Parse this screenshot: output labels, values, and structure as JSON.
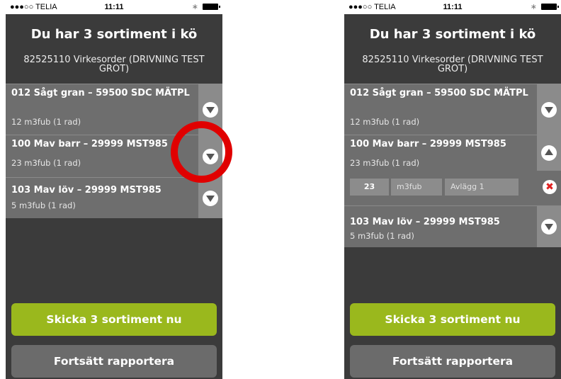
{
  "status_bar": {
    "carrier": "●●●○○ TELIA",
    "time": "11:11",
    "bluetooth": "∗"
  },
  "colors": {
    "background": "#3b3b3b",
    "item": "#6e6e6e",
    "toggle": "#8b8b8b",
    "primary": "#9ab81d",
    "secondary": "#6b6b6b",
    "highlight": "#e00000"
  },
  "left_screen": {
    "title": "Du har 3 sortiment i kö",
    "subtitle": "82525110 Virkesorder (DRIVNING TEST GROT)",
    "items": [
      {
        "title": "012 Sågt gran – 59500 SDC MÄTPL",
        "sub": "12 m3fub (1 rad)",
        "icon": "chevron-down-icon"
      },
      {
        "title": "100 Mav barr – 29999 MST985",
        "sub": "23 m3fub (1 rad)",
        "icon": "chevron-down-icon"
      },
      {
        "title": "103 Mav löv – 29999 MST985",
        "sub": "5 m3fub (1 rad)",
        "icon": "chevron-down-icon"
      }
    ],
    "send_button": "Skicka 3 sortiment nu",
    "continue_button": "Fortsätt rapportera"
  },
  "right_screen": {
    "title": "Du har 3 sortiment i kö",
    "subtitle": "82525110 Virkesorder (DRIVNING TEST GROT)",
    "items": [
      {
        "title": "012 Sågt gran – 59500 SDC MÄTPL",
        "sub": "12 m3fub (1 rad)",
        "icon": "chevron-down-icon"
      },
      {
        "title": "100 Mav barr – 29999 MST985",
        "sub": "23 m3fub (1 rad)",
        "icon": "chevron-up-icon",
        "detail": {
          "quantity": "23",
          "unit": "m3fub",
          "destination": "Avlägg 1",
          "remove_icon": "remove-icon"
        }
      },
      {
        "title": "103 Mav löv – 29999 MST985",
        "sub": "5 m3fub (1 rad)",
        "icon": "chevron-down-icon"
      }
    ],
    "send_button": "Skicka 3 sortiment nu",
    "continue_button": "Fortsätt rapportera"
  }
}
